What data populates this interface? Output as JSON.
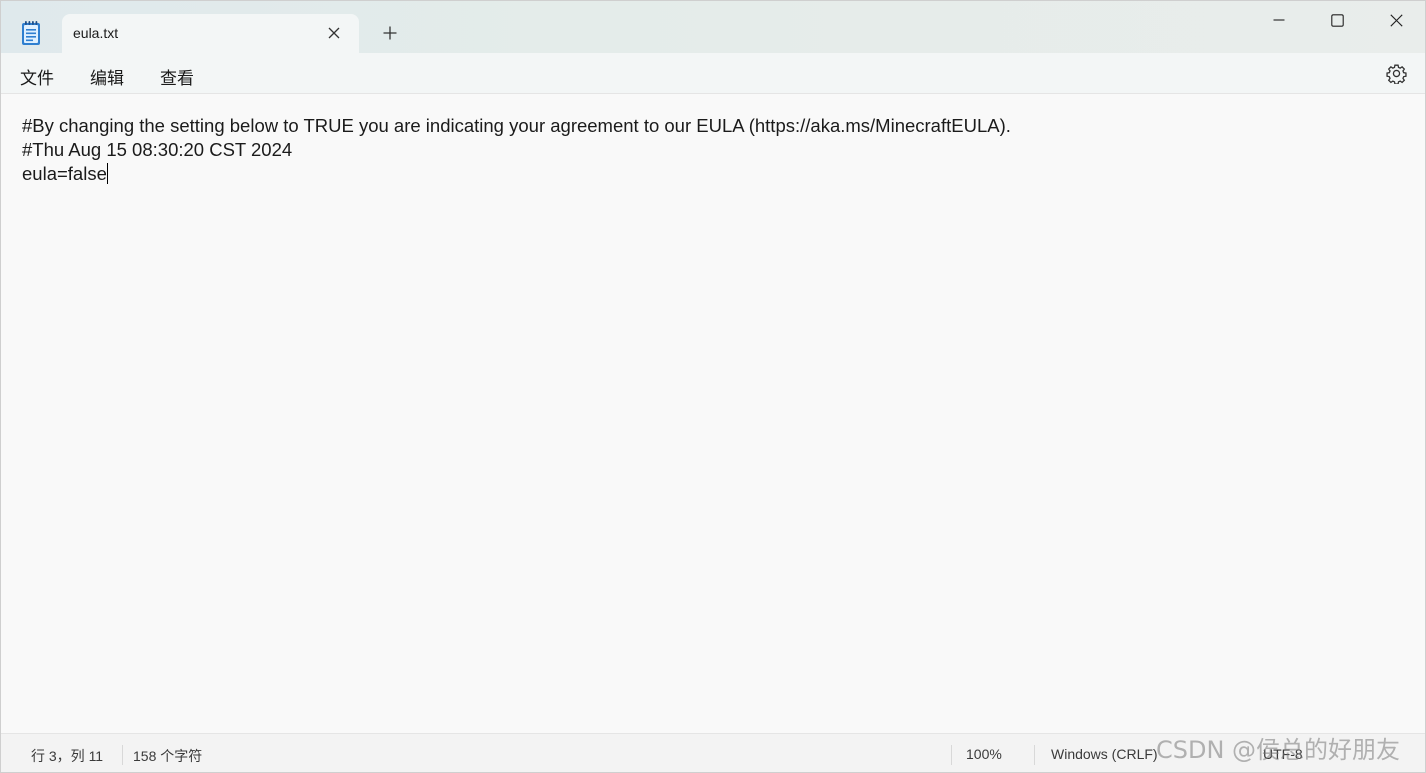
{
  "tab": {
    "title": "eula.txt"
  },
  "menu": {
    "file": "文件",
    "edit": "编辑",
    "view": "查看"
  },
  "editor": {
    "lines": [
      "#By changing the setting below to TRUE you are indicating your agreement to our EULA (https://aka.ms/MinecraftEULA).",
      "#Thu Aug 15 08:30:20 CST 2024",
      "eula=false"
    ]
  },
  "status": {
    "position": "行 3，列 11",
    "chars": "158 个字符",
    "zoom": "100%",
    "line_ending": "Windows (CRLF)",
    "encoding": "UTF-8"
  },
  "watermark": "CSDN @侯总的好朋友",
  "icons": {
    "app": "notepad-icon",
    "tab_close": "close-icon",
    "new_tab": "plus-icon",
    "minimize": "minimize-icon",
    "maximize": "maximize-icon",
    "close": "close-icon",
    "settings": "gear-icon"
  }
}
